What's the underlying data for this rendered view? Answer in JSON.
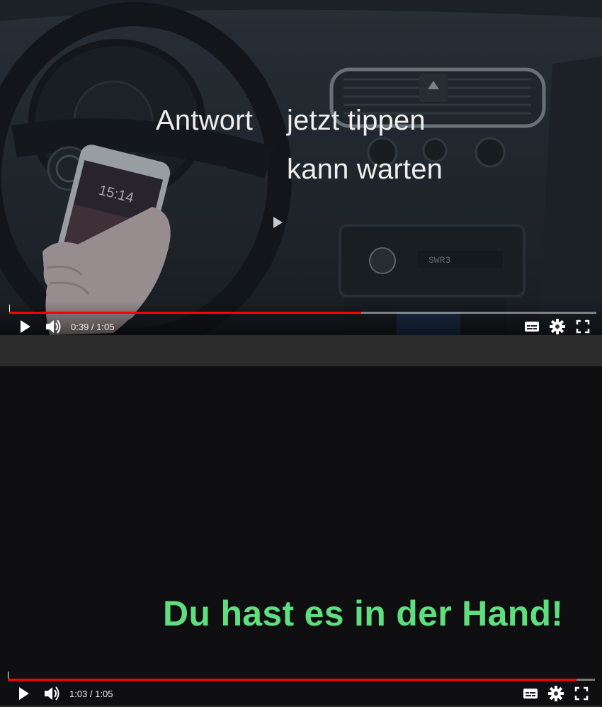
{
  "top_player": {
    "overlay_line1_left": "Antwort",
    "overlay_line1_right": "jetzt tippen",
    "overlay_line2": "kann warten",
    "phone_clock": "15:14",
    "radio_display": "SWR3",
    "progress_fraction": 0.6,
    "current_time": "0:39",
    "separator": " / ",
    "duration": "1:05",
    "icons": [
      "play-icon",
      "volume-icon",
      "subtitles-icon",
      "settings-icon",
      "fullscreen-icon"
    ]
  },
  "bottom_player": {
    "caption": "Du hast es in der Hand!",
    "caption_color": "#5fde7f",
    "progress_fraction": 0.969,
    "current_time": "1:03",
    "separator": " / ",
    "duration": "1:05",
    "icons": [
      "play-icon",
      "volume-icon",
      "subtitles-icon",
      "settings-icon",
      "fullscreen-icon"
    ]
  },
  "colors": {
    "progress_played": "#ff0000",
    "progress_track": "rgba(255,255,255,0.45)"
  }
}
